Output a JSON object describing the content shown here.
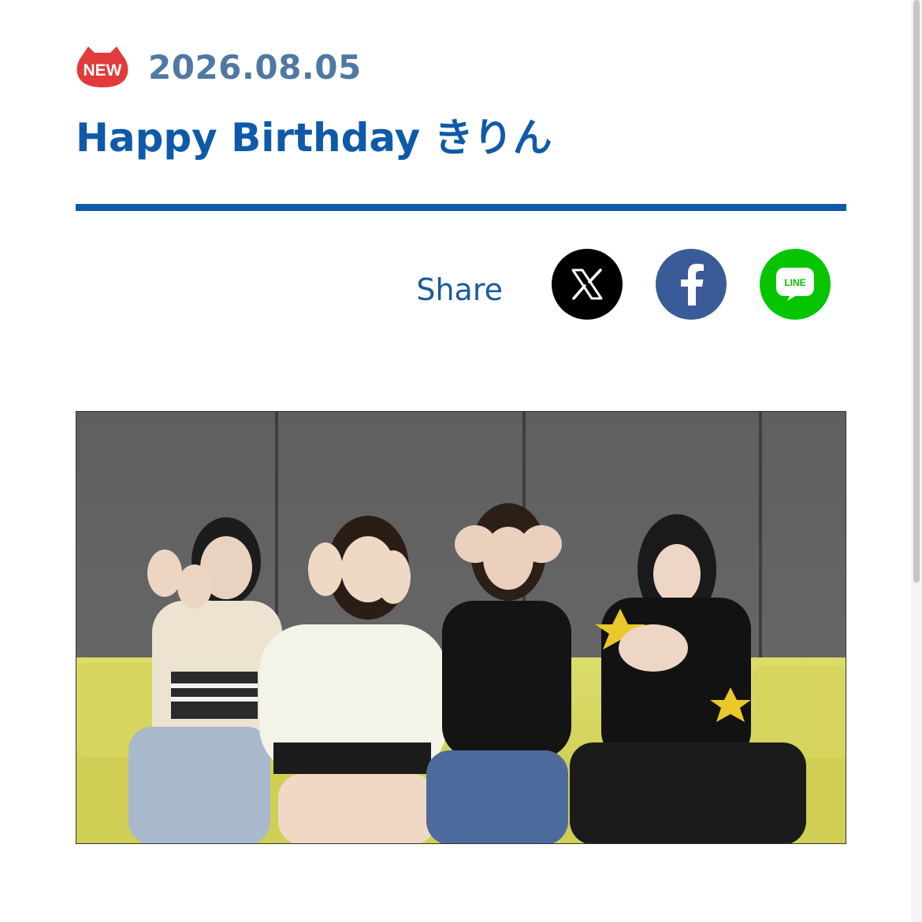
{
  "article": {
    "badge": "NEW",
    "date": "2026.08.05",
    "title": "Happy Birthday きりん"
  },
  "share": {
    "label": "Share",
    "buttons": [
      {
        "name": "x",
        "icon": "x-logo-icon",
        "color": "#000000"
      },
      {
        "name": "facebook",
        "icon": "facebook-f-icon",
        "color": "#3b5b98"
      },
      {
        "name": "line",
        "icon": "line-logo-icon",
        "color": "#06c400",
        "text": "LINE"
      }
    ]
  },
  "photo": {
    "description_icon": "group-photo"
  },
  "colors": {
    "accent": "#0f5aa8",
    "date": "#4f78a3",
    "badge": "#e23b3b"
  }
}
